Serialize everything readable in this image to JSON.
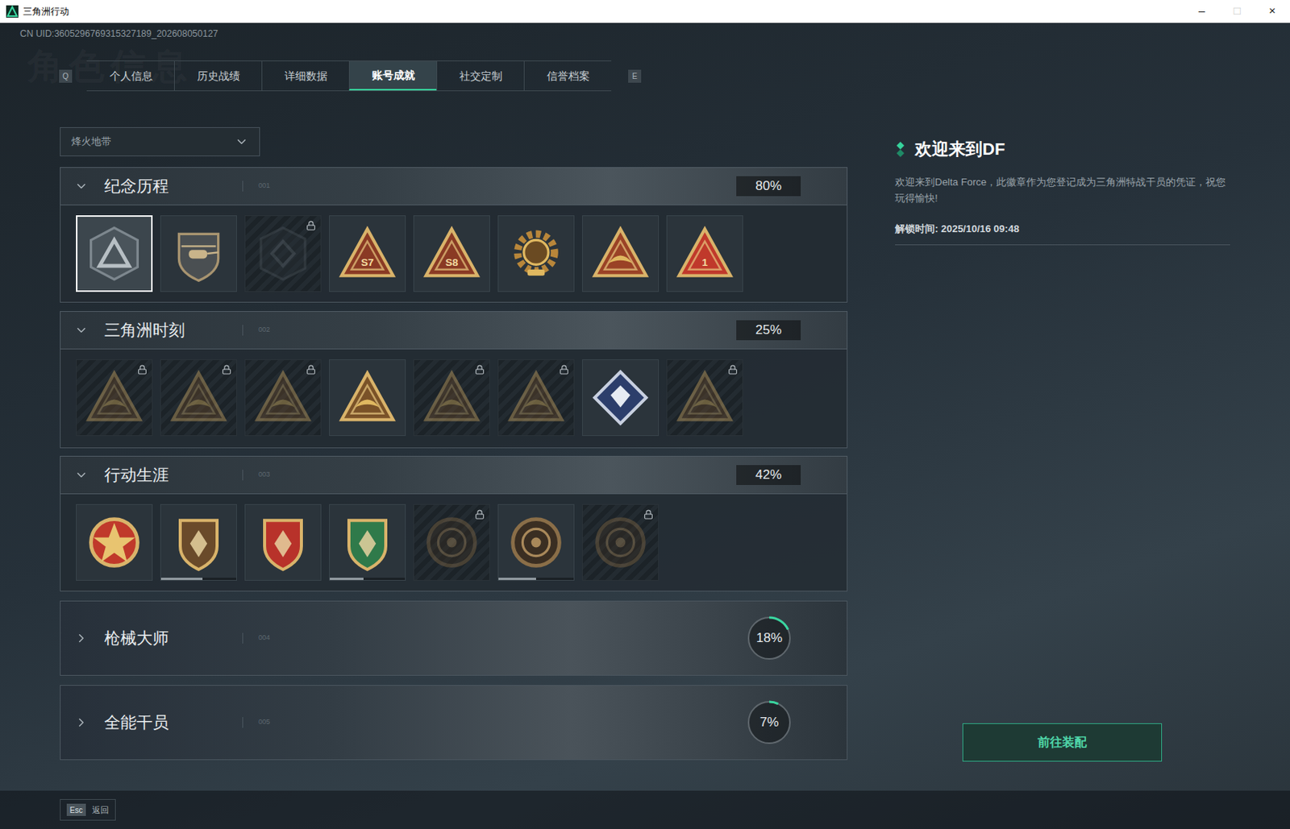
{
  "window": {
    "title": "三角洲行动",
    "controls": [
      {
        "glyph": "–",
        "disabled": false
      },
      {
        "glyph": "□",
        "disabled": true
      },
      {
        "glyph": "×",
        "disabled": false
      }
    ]
  },
  "uid": "CN UID:3605296769315327189_202608050127",
  "watermark": "角色信息",
  "tabs": {
    "prev_key": "Q",
    "next_key": "E",
    "items": [
      {
        "label": "个人信息",
        "selected": false
      },
      {
        "label": "历史战绩",
        "selected": false
      },
      {
        "label": "详细数据",
        "selected": false
      },
      {
        "label": "账号成就",
        "selected": true
      },
      {
        "label": "社交定制",
        "selected": false
      },
      {
        "label": "信誉档案",
        "selected": false
      }
    ]
  },
  "mode_select": {
    "value": "烽火地带",
    "expanded": false
  },
  "sections": [
    {
      "title": "纪念历程",
      "code": "001",
      "percent": "80%",
      "level": 0.8,
      "kind": "bar",
      "expanded": true,
      "badges": [
        {
          "kind": "delta",
          "color": "#4a545b",
          "locked": false,
          "selected": true
        },
        {
          "kind": "heli",
          "color": "#4a4f52",
          "locked": false,
          "selected": false
        },
        {
          "kind": "hex",
          "color": "#2a3036",
          "locked": true,
          "selected": false
        },
        {
          "kind": "triangle",
          "color": "#8a3a24",
          "mark": "S7",
          "locked": false,
          "selected": false
        },
        {
          "kind": "triangle",
          "color": "#8a3a24",
          "mark": "S8",
          "locked": false,
          "selected": false
        },
        {
          "kind": "gear",
          "color": "#b8863a",
          "locked": false,
          "selected": false
        },
        {
          "kind": "triangle",
          "color": "#9a4226",
          "locked": false,
          "selected": false
        },
        {
          "kind": "triangle",
          "color": "#c0392b",
          "mark": "1",
          "locked": false,
          "selected": false
        }
      ]
    },
    {
      "title": "三角洲时刻",
      "code": "002",
      "percent": "25%",
      "level": 0.25,
      "kind": "bar",
      "expanded": true,
      "badges": [
        {
          "kind": "triangle",
          "color": "#6b4a2a",
          "locked": true,
          "selected": false
        },
        {
          "kind": "triangle",
          "color": "#6b4a2a",
          "locked": true,
          "selected": false
        },
        {
          "kind": "triangle",
          "color": "#6b4a2a",
          "locked": true,
          "selected": false
        },
        {
          "kind": "triangle",
          "color": "#7a5228",
          "locked": false,
          "selected": false
        },
        {
          "kind": "triangle",
          "color": "#6b4a2a",
          "locked": true,
          "selected": false
        },
        {
          "kind": "triangle",
          "color": "#6b4a2a",
          "locked": true,
          "selected": false
        },
        {
          "kind": "diamond",
          "color": "#2c3e6b",
          "locked": false,
          "selected": false
        },
        {
          "kind": "triangle",
          "color": "#6b4a2a",
          "locked": true,
          "selected": false
        }
      ]
    },
    {
      "title": "行动生涯",
      "code": "003",
      "percent": "42%",
      "level": 0.42,
      "kind": "bar",
      "expanded": true,
      "badges": [
        {
          "kind": "medal",
          "color": "#c0392b",
          "locked": false,
          "selected": false
        },
        {
          "kind": "shield",
          "color": "#6a4a2a",
          "locked": false,
          "selected": false,
          "level": 0.55
        },
        {
          "kind": "shield",
          "color": "#b8322a",
          "locked": false,
          "selected": false
        },
        {
          "kind": "shield",
          "color": "#2f7a4a",
          "locked": false,
          "selected": false,
          "level": 0.45
        },
        {
          "kind": "coin",
          "color": "#3a2e22",
          "locked": true,
          "selected": false
        },
        {
          "kind": "coin",
          "color": "#3a2e22",
          "locked": false,
          "selected": false,
          "level": 0.5
        },
        {
          "kind": "coin",
          "color": "#3a2e22",
          "locked": true,
          "selected": false
        }
      ]
    },
    {
      "title": "枪械大师",
      "code": "004",
      "percent": "18%",
      "level": 0.18,
      "kind": "ring",
      "expanded": false,
      "badges": []
    },
    {
      "title": "全能干员",
      "code": "005",
      "percent": "7%",
      "level": 0.07,
      "kind": "ring",
      "expanded": false,
      "badges": []
    }
  ],
  "detail": {
    "title": "欢迎来到DF",
    "description": "欢迎来到Delta Force，此徽章作为您登记成为三角洲特战干员的凭证，祝您玩得愉快!",
    "unlock": "解锁时间: 2025/10/16 09:48",
    "button": "前往装配"
  },
  "footer": {
    "key": "Esc",
    "label": "返回"
  }
}
